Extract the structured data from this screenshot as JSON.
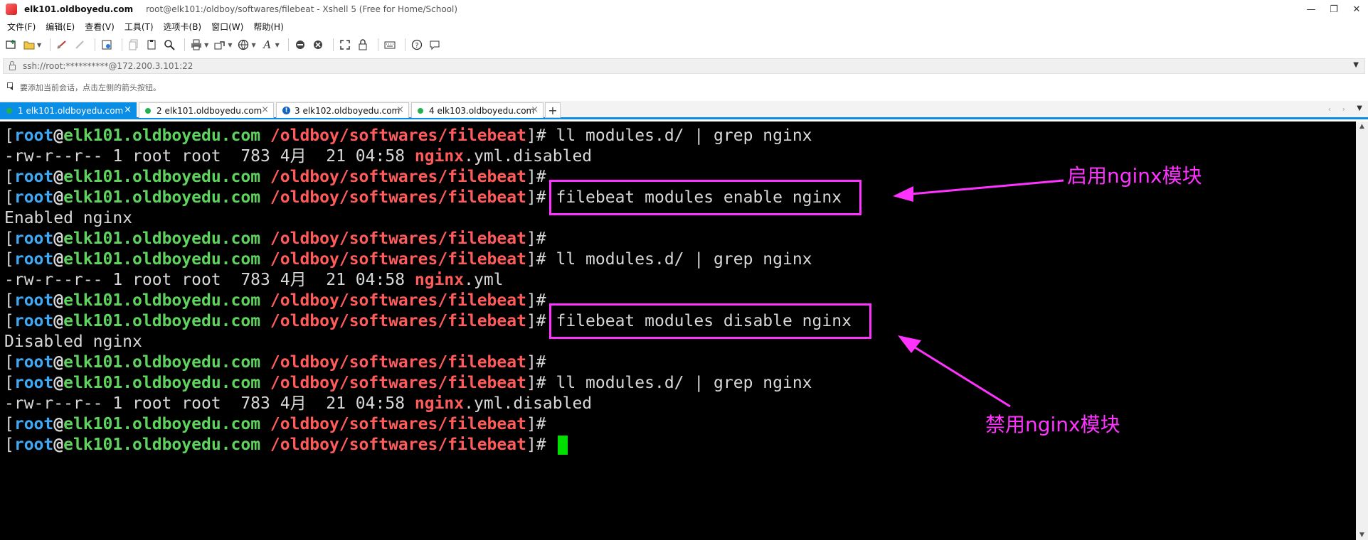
{
  "window": {
    "title": "elk101.oldboyedu.com",
    "subtitle": "root@elk101:/oldboy/softwares/filebeat - Xshell 5 (Free for Home/School)",
    "controls": [
      "—",
      "❐",
      "✕"
    ]
  },
  "menu": [
    "文件(F)",
    "编辑(E)",
    "查看(V)",
    "工具(T)",
    "选项卡(B)",
    "窗口(W)",
    "帮助(H)"
  ],
  "address": {
    "text": "ssh://root:**********@172.200.3.101:22"
  },
  "hint": {
    "text": "要添加当前会话，点击左侧的箭头按钮。"
  },
  "tabs": [
    {
      "label": "1 elk101.oldboyedu.com",
      "status": "connected",
      "active": true
    },
    {
      "label": "2 elk101.oldboyedu.com",
      "status": "connected",
      "active": false
    },
    {
      "label": "3 elk102.oldboyedu.com",
      "status": "warning",
      "active": false
    },
    {
      "label": "4 elk103.oldboyedu.com",
      "status": "connected",
      "active": false
    }
  ],
  "terminal": {
    "prompt": {
      "open": "[",
      "user": "root",
      "at": "@",
      "host": "elk101.oldboyedu.com",
      "path": "/oldboy/softwares/filebeat",
      "close": "]#"
    },
    "lines": [
      {
        "type": "prompt",
        "cmd": " ll modules.d/ | grep nginx"
      },
      {
        "type": "ls",
        "pre": "-rw-r--r-- 1 root root  783 4月  21 04:58 ",
        "hl": "nginx",
        "post": ".yml.disabled"
      },
      {
        "type": "prompt",
        "cmd": ""
      },
      {
        "type": "prompt",
        "cmd": " filebeat modules enable nginx"
      },
      {
        "type": "text",
        "text": "Enabled nginx"
      },
      {
        "type": "prompt",
        "cmd": ""
      },
      {
        "type": "prompt",
        "cmd": " ll modules.d/ | grep nginx"
      },
      {
        "type": "ls",
        "pre": "-rw-r--r-- 1 root root  783 4月  21 04:58 ",
        "hl": "nginx",
        "post": ".yml"
      },
      {
        "type": "prompt",
        "cmd": ""
      },
      {
        "type": "prompt",
        "cmd": " filebeat modules disable nginx"
      },
      {
        "type": "text",
        "text": "Disabled nginx"
      },
      {
        "type": "prompt",
        "cmd": ""
      },
      {
        "type": "prompt",
        "cmd": " ll modules.d/ | grep nginx"
      },
      {
        "type": "ls",
        "pre": "-rw-r--r-- 1 root root  783 4月  21 04:58 ",
        "hl": "nginx",
        "post": ".yml.disabled"
      },
      {
        "type": "prompt",
        "cmd": ""
      },
      {
        "type": "prompt",
        "cmd": " ",
        "cursor": true
      }
    ]
  },
  "annotations": {
    "enable_label": "启用nginx模块",
    "disable_label": "禁用nginx模块",
    "color": "#ff33ff"
  },
  "colors": {
    "terminal_bg": "#000000",
    "user": "#3fa9f5",
    "host": "#5ed35e",
    "path": "#ff5b5b",
    "cursor": "#00e000",
    "tab_active": "#0a8de4"
  }
}
